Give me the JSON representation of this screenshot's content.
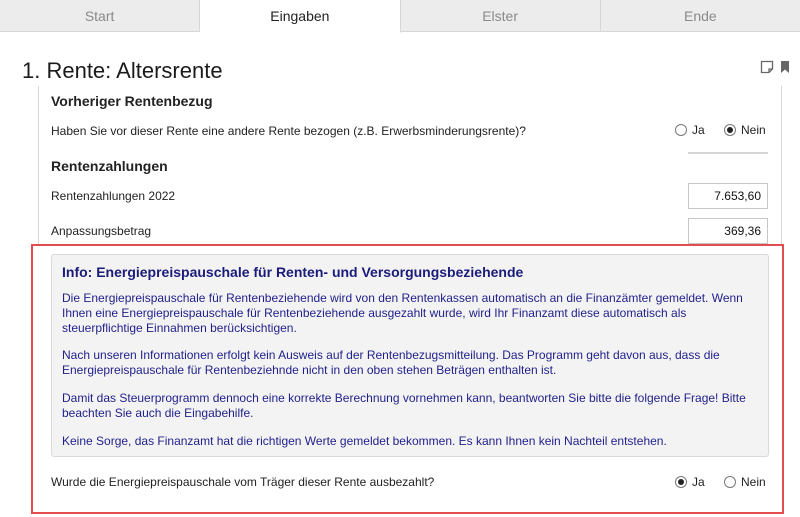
{
  "tabs": [
    {
      "label": "Start",
      "active": false
    },
    {
      "label": "Eingaben",
      "active": true
    },
    {
      "label": "Elster",
      "active": false
    },
    {
      "label": "Ende",
      "active": false
    }
  ],
  "page": {
    "title": "1. Rente: Altersrente",
    "icons": [
      "note-icon",
      "bookmark-icon"
    ]
  },
  "vorheriger": {
    "heading": "Vorheriger Rentenbezug",
    "question": "Haben Sie vor dieser Rente eine andere Rente bezogen (z.B. Erwerbsminderungsrente)?",
    "options": [
      "Ja",
      "Nein"
    ],
    "selected": "Nein"
  },
  "rentenzahlungen": {
    "heading": "Rentenzahlungen",
    "rows": [
      {
        "label": "Rentenzahlungen 2022",
        "value": "7.653,60"
      },
      {
        "label": "Anpassungsbetrag",
        "value": "369,36"
      }
    ]
  },
  "info": {
    "title": "Info: Energiepreispauschale für Renten- und Versorgungsbeziehende",
    "paragraphs": [
      "Die Energiepreispauschale für Rentenbeziehende wird von den Rentenkassen automatisch an die Finanzämter gemeldet. Wenn Ihnen eine Energiepreispauschale für Rentenbeziehende ausgezahlt wurde, wird Ihr Finanzamt diese automatisch als steuerpflichtige Einnahmen berücksichtigen.",
      "Nach unseren Informationen erfolgt kein Ausweis auf der Rentenbezugsmitteilung. Das Programm geht davon aus, dass die Energiepreispauschale für Rentenbeziehnde nicht in den oben stehen Beträgen enthalten ist.",
      "Damit das Steuerprogramm dennoch eine korrekte Berechnung vornehmen kann, beantworten Sie bitte die folgende Frage! Bitte beachten Sie auch die Eingabehilfe.",
      "Keine Sorge, das Finanzamt hat die richtigen Werte gemeldet bekommen. Es kann Ihnen kein Nachteil entstehen."
    ]
  },
  "epp_question": {
    "question": "Wurde die Energiepreispauschale vom Träger dieser Rente ausbezahlt?",
    "options": [
      "Ja",
      "Nein"
    ],
    "selected": "Ja"
  },
  "colors": {
    "highlight_border": "#e24d4d",
    "info_text": "#1f1f8a",
    "info_background": "#f3f3f3"
  }
}
